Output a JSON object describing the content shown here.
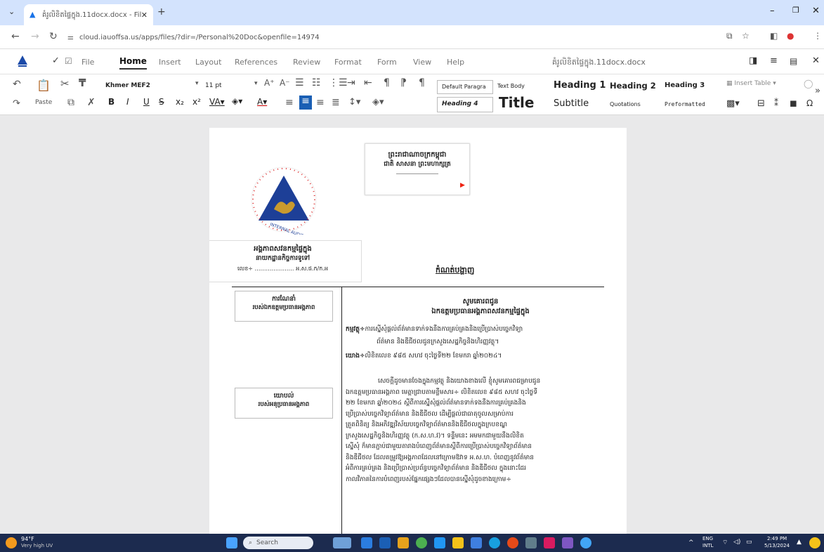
{
  "browser": {
    "tab_title": "គំរូលិខិតផ្ទៃក្នុង.11docx.docx - Files",
    "new_tab": "+",
    "url": "cloud.iauoffsa.us/apps/files/?dir=/Personal%20Doc&openfile=14974",
    "window_controls": {
      "minimize": "–",
      "restore": "❐",
      "close": "✕"
    }
  },
  "menu": {
    "items": [
      "File",
      "Home",
      "Insert",
      "Layout",
      "References",
      "Review",
      "Format",
      "Form",
      "View",
      "Help"
    ],
    "active": "Home",
    "doc_title": "គំរូលិខិតផ្ទៃក្នុង.11docx.docx"
  },
  "toolbar": {
    "font_name": "Khmer MEF2",
    "font_size": "11 pt",
    "paste_label": "Paste",
    "styles": {
      "default": "Default Paragra",
      "text_body": "Text Body",
      "heading1": "Heading 1",
      "heading2": "Heading 2",
      "heading3": "Heading 3",
      "heading4": "Heading 4",
      "title": "Title",
      "subtitle": "Subtitle",
      "quotations": "Quotations",
      "preformatted": "Preformatted"
    },
    "insert_table": "Insert Table"
  },
  "document": {
    "kingdom_line1": "ព្រះរាជាណាចក្រកម្ពុជា",
    "kingdom_line2": "ជាតិ សាសនា ព្រះមហាក្សត្រ",
    "logo_text": "INTERNAL AUDIT UNIT",
    "org_line1": "អង្គភាពសវនកម្មផ្ទៃក្នុង",
    "org_line2": "នាយកដ្ឋានកិច្ចការទូទៅ",
    "ref_line": "លេខ÷ ………………… អ.ស.ផ.ក/ក.អ",
    "memo_title": "កំណត់បង្ហាញ",
    "left_cell1_line1": "ការណែនាំ",
    "left_cell1_line2": "របស់ឯកឧត្ដមប្រធានអង្គភាព",
    "left_cell2_line1": "យោបល់",
    "left_cell2_line2": "របស់អនុប្រធានអង្គភាព",
    "to_line1": "សូមគោរពជូន",
    "to_line2": "ឯកឧត្តមប្រធានអង្គភាពសវនកម្មផ្ទៃក្នុង",
    "subject_label": "កម្មវត្ថុ÷",
    "subject_text": "ការស្នើសុំផ្តល់ព័ត៌មានទាក់ទងនឹងការគ្រប់គ្រងនិងប្រើប្រាស់បច្ចេកវិទ្យា",
    "subject_text2": "ព័ត៌មាន និងឌីជីថលជូនក្រសួងសេដ្ឋកិច្ចនិងហិរញ្ញវត្ថុ។",
    "ref_label": "យោង÷",
    "ref_text": "លិខិតលេខ ៩៨៥ សហវ ចុះថ្ងៃទី២២ ខែមករា ឆ្នាំ២០២៤។",
    "body": [
      "សេចក្តីដូចមានចែងក្នុងកម្មវត្ថុ និងយោងខាងលើ ខ្ញុំសូមគោរពជម្រាបជូន",
      "ឯកឧត្តមប្រធានអង្គភាព មេត្តាជ្រាបតាមខ្លឹមសារ÷ លិខិតលេខ ៩៨៥ សហវ ចុះថ្ងៃទី",
      "២២ ខែមករា ឆ្នាំ២០២៤ ស្ដីពីការស្នើសុំផ្ដល់ព័ត៌មានទាក់ទងនឹងការគ្រប់គ្រងនិង",
      "ប្រើប្រាស់បច្ចេកវិទ្យាព័ត៌មាន និងឌីជីថល ដើម្បីផ្តល់ជាធាតុចូលសម្រាប់ការ",
      "ត្រួតពិនិត្យ និងអភិវឌ្ឍវិស័យបច្ចេកវិទ្យាព័ត៌មាននិងឌីជីថលក្នុងក្របខណ្ឌ",
      "ក្រសួងសេដ្ឋកិច្ចនិងហិរញ្ញវត្ថុ (ក.ស.ហ.វ)។ ទន្ទឹមនេះ អមមកជាមួយនឹងលិខិត",
      "ស្នើសុំ ក៏មានភ្ជាប់ជាមួយតារាងបំពេញព័ត៌មានស្ដីពីការប្រើប្រាស់បច្ចេកវិទ្យាព័ត៌មាន",
      "និងឌីជីថល ដែលតម្រូវឱ្យអង្គភាពដែលនៅក្រោមឱវាទ អ.ស.ហ. បំពេញនូវព័ត៌មាន",
      "អំពីការគ្រប់គ្រង និងប្រើប្រាស់ប្រព័ន្ធបច្ចេកវិទ្យាព័ត៌មាន និងឌីជីថល ក្នុងនោះដែរ",
      "កាលវិភាគនៃការបំពេញរបស់ផ្នែកផ្សេងៗដែលបានស្នើសុំដូចខាងក្រោម÷"
    ]
  },
  "taskbar": {
    "weather_temp": "94°F",
    "weather_desc": "Very high UV",
    "search_placeholder": "Search",
    "lang_top": "ENG",
    "lang_bottom": "INTL",
    "time": "2:49 PM",
    "date": "5/13/2024"
  }
}
